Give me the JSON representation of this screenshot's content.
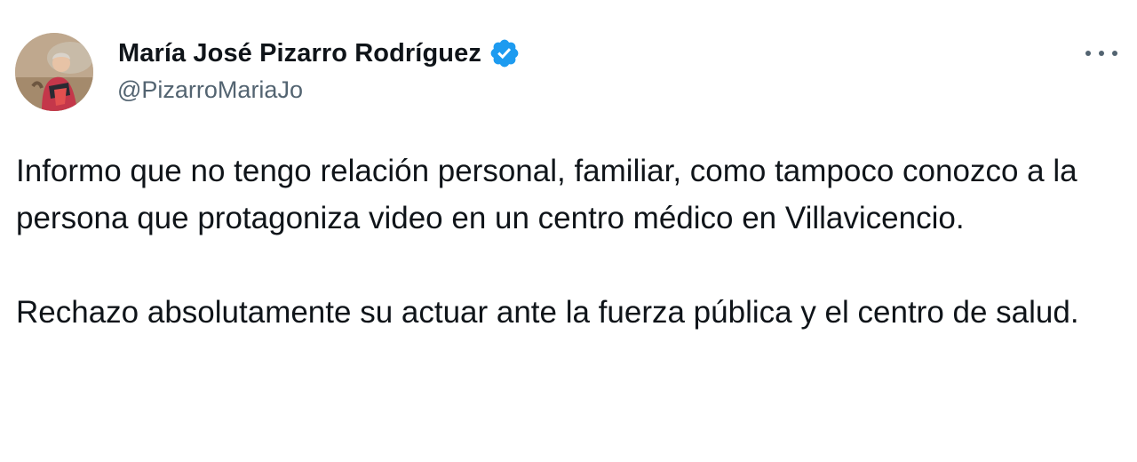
{
  "author": {
    "display_name": "María José Pizarro Rodríguez",
    "handle": "@PizarroMariaJo",
    "verified": true,
    "verified_color": "#1d9bf0"
  },
  "icons": {
    "avatar": "profile-photo",
    "verified": "verified-badge-icon",
    "more": "more-options-icon"
  },
  "tweet": {
    "paragraphs": [
      "Informo que no tengo relación personal, familiar, como tampoco conozco a la persona que protagoniza video en un centro médico en Villavicencio.",
      "Rechazo absolutamente su actuar ante la fuerza pública y el centro de salud."
    ]
  }
}
